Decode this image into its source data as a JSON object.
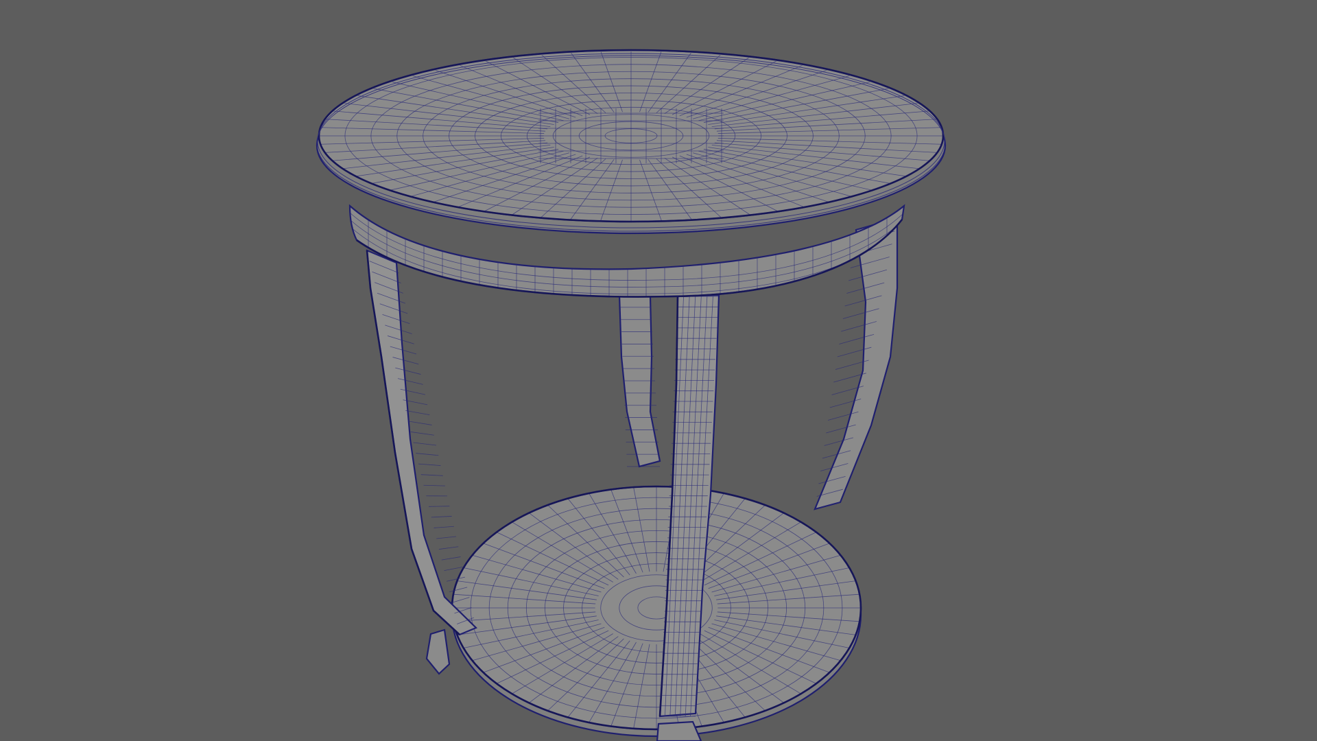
{
  "scene": {
    "object": "side-table-wireframe",
    "background_color": "#5d5d5d",
    "surface_color": "#8b8b8b",
    "wire_color": "#2a2a78",
    "shading": "wireframe-on-shaded"
  }
}
